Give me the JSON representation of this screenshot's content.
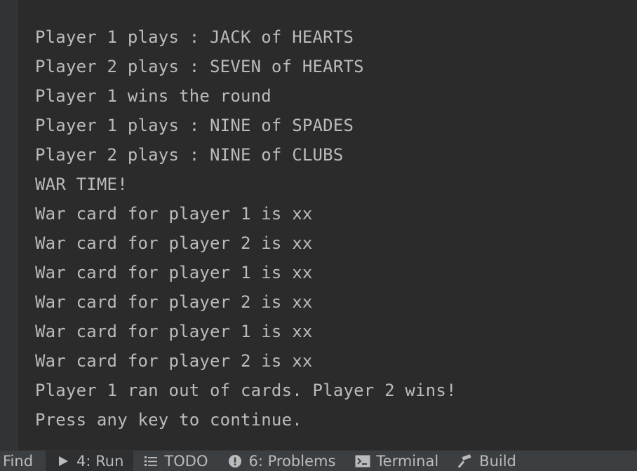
{
  "console": {
    "lines": [
      "Player 1 plays : JACK of HEARTS",
      "Player 2 plays : SEVEN of HEARTS",
      "Player 1 wins the round",
      "Player 1 plays : NINE of SPADES",
      "Player 2 plays : NINE of CLUBS",
      "WAR TIME!",
      "War card for player 1 is xx",
      "War card for player 2 is xx",
      "War card for player 1 is xx",
      "War card for player 2 is xx",
      "War card for player 1 is xx",
      "War card for player 2 is xx",
      "Player 1 ran out of cards. Player 2 wins!",
      "Press any key to continue."
    ]
  },
  "toolbar": {
    "find_label": "Find",
    "run_label": "4: Run",
    "todo_label": "TODO",
    "problems_label": "6: Problems",
    "terminal_label": "Terminal",
    "build_label": "Build"
  },
  "colors": {
    "background": "#2b2b2b",
    "text": "#bbbbbb",
    "toolbar": "#3c3f41"
  }
}
